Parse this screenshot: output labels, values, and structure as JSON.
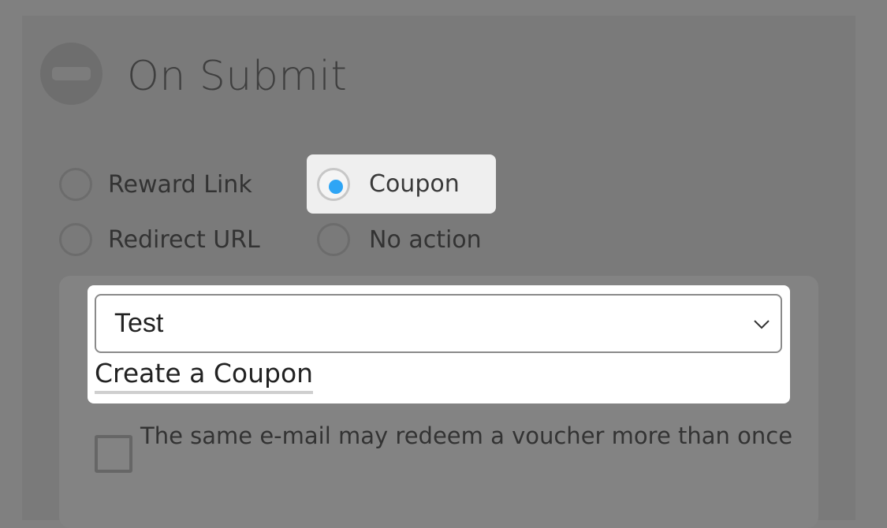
{
  "section": {
    "title": "On Submit"
  },
  "options": [
    {
      "label": "Reward Link",
      "selected": false
    },
    {
      "label": "Coupon",
      "selected": true
    },
    {
      "label": "Redirect URL",
      "selected": false
    },
    {
      "label": "No action",
      "selected": false
    }
  ],
  "coupon": {
    "selected_value": "Test",
    "create_link_label": "Create a Coupon"
  },
  "redeem_option": {
    "label": "The same e-mail may redeem a voucher more than once",
    "checked": false
  },
  "colors": {
    "accent": "#2ea5f5",
    "overlay": "#808080"
  },
  "icons": {
    "collapse": "minus-circle-icon",
    "dropdown": "chevron-down-icon"
  }
}
